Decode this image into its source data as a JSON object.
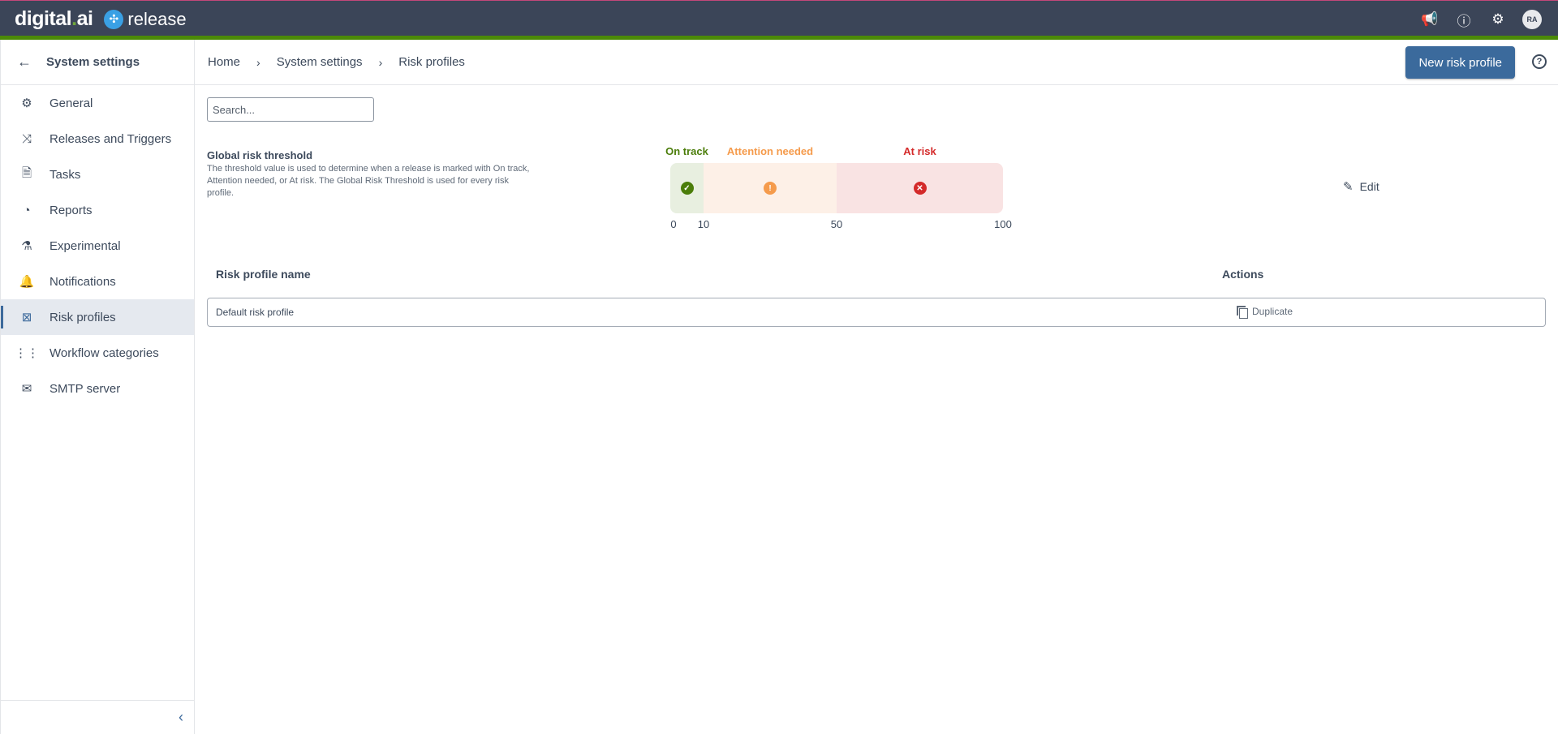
{
  "topbar": {
    "brand": "digital.ai",
    "product": "release",
    "icons": [
      "megaphone-icon",
      "help-icon",
      "gear-icon"
    ],
    "avatar_initials": "RA",
    "accent_colors": {
      "header": "#3b4558",
      "top_stripe": "#c2477a",
      "bottom_stripe": "#4b8a08"
    }
  },
  "sidebar": {
    "title": "System settings",
    "items": [
      {
        "label": "General",
        "icon": "gear-icon",
        "active": false
      },
      {
        "label": "Releases and Triggers",
        "icon": "shuffle-icon",
        "active": false
      },
      {
        "label": "Tasks",
        "icon": "task-file-icon",
        "active": false
      },
      {
        "label": "Reports",
        "icon": "pie-chart-icon",
        "active": false
      },
      {
        "label": "Experimental",
        "icon": "flask-icon",
        "active": false
      },
      {
        "label": "Notifications",
        "icon": "bell-icon",
        "active": false
      },
      {
        "label": "Risk profiles",
        "icon": "risk-icon",
        "active": true
      },
      {
        "label": "Workflow categories",
        "icon": "workflow-icon",
        "active": false
      },
      {
        "label": "SMTP server",
        "icon": "mail-icon",
        "active": false
      }
    ]
  },
  "breadcrumb": [
    "Home",
    "System settings",
    "Risk profiles"
  ],
  "header": {
    "new_button": "New risk profile"
  },
  "search": {
    "placeholder": "Search...",
    "value": ""
  },
  "global_threshold": {
    "title": "Global risk threshold",
    "description": "The threshold value is used to determine when a release is marked with On track, Attention needed, or At risk. The Global Risk Threshold is used for every risk profile.",
    "segments": [
      {
        "label": "On track",
        "from": 0,
        "to": 10,
        "color": "#4b7d0a",
        "bg": "#e8efe0"
      },
      {
        "label": "Attention needed",
        "from": 10,
        "to": 50,
        "color": "#f59b4c",
        "bg": "#fdf0e7"
      },
      {
        "label": "At risk",
        "from": 50,
        "to": 100,
        "color": "#d42a2a",
        "bg": "#f9e3e3"
      }
    ],
    "ticks": [
      "0",
      "10",
      "50",
      "100"
    ],
    "edit_label": "Edit"
  },
  "table": {
    "columns": [
      "Risk profile name",
      "Actions"
    ],
    "rows": [
      {
        "name": "Default risk profile",
        "action": "Duplicate"
      }
    ]
  }
}
